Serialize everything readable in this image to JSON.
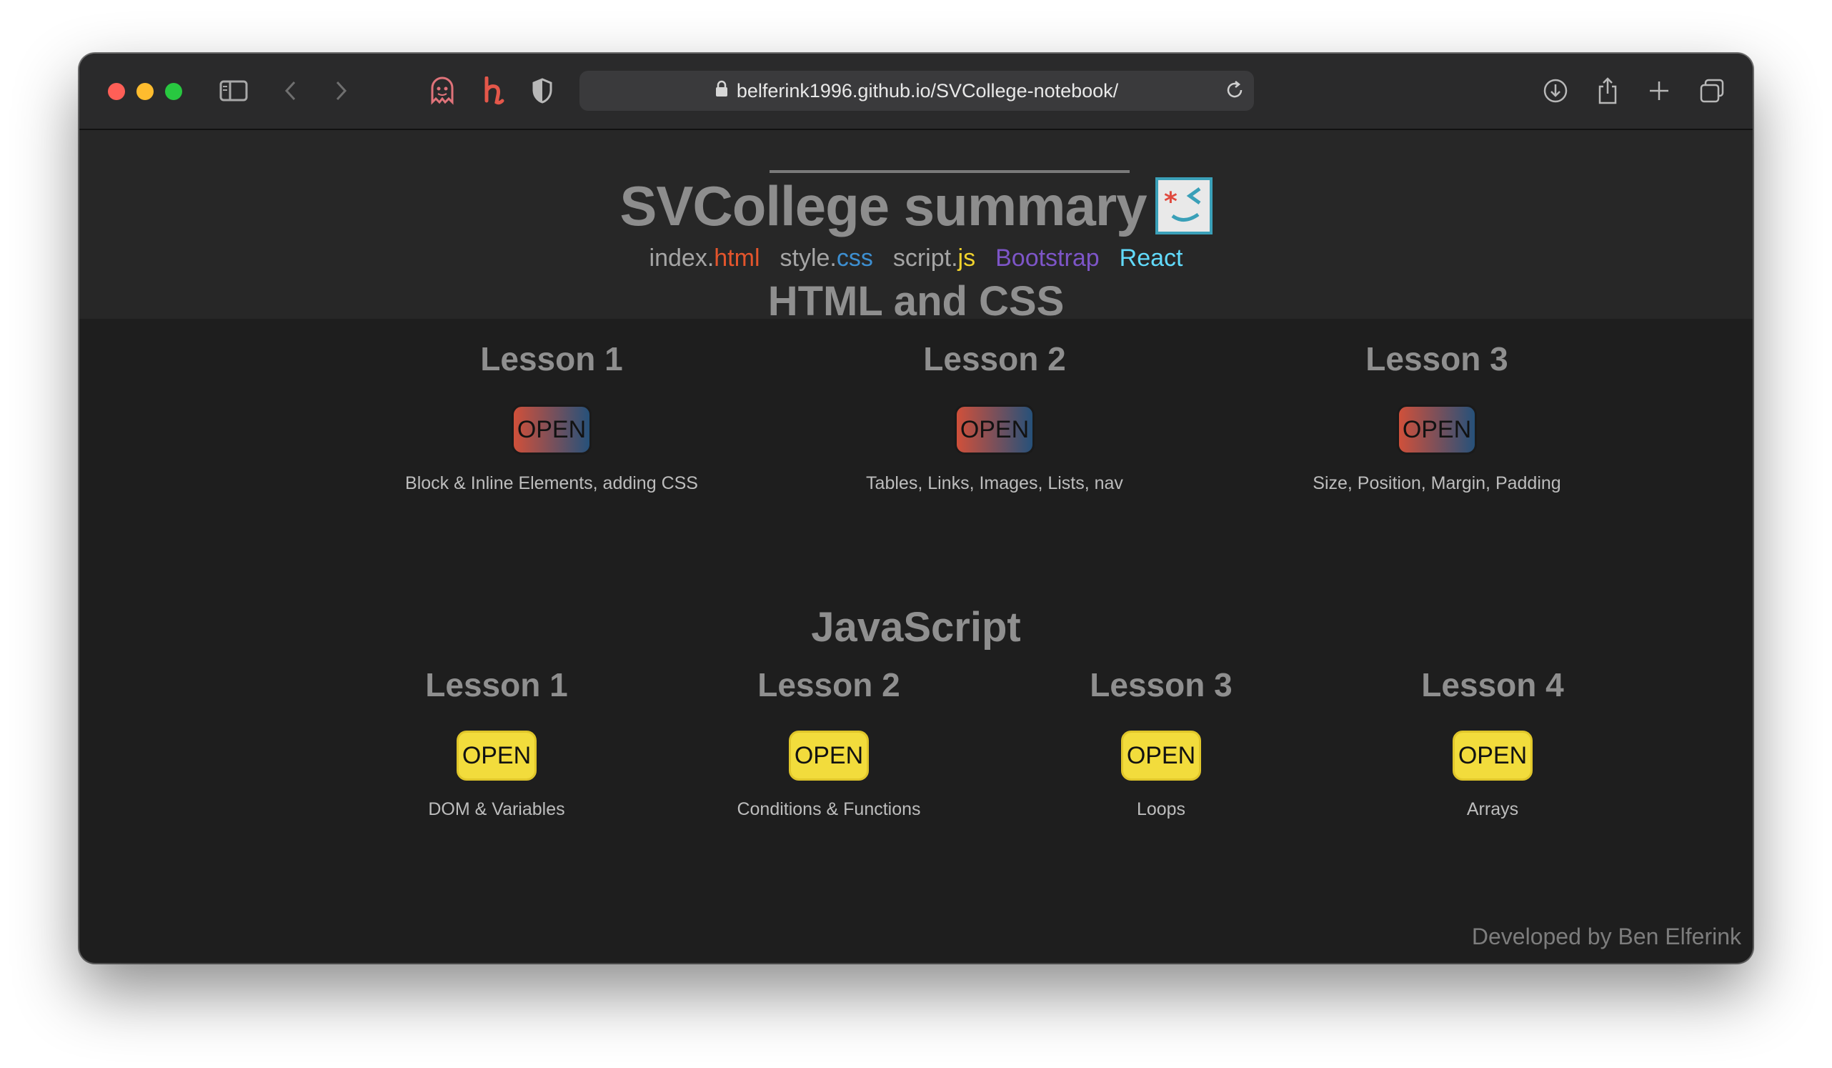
{
  "browser": {
    "url": "belferink1996.github.io/SVCollege-notebook/",
    "icons": [
      "sidebar-icon",
      "back-icon",
      "forward-icon",
      "ghost-extension-icon",
      "honey-extension-icon",
      "privacy-shield-icon",
      "lock-icon",
      "reload-icon",
      "download-icon",
      "share-icon",
      "new-tab-icon",
      "tab-overview-icon"
    ],
    "traffic_lights": {
      "close": "#ff5f57",
      "minimize": "#febc2e",
      "maximize": "#28c840"
    }
  },
  "header": {
    "title": "SVCollege summary",
    "logo_icon": "winking-face-logo-icon",
    "nav": [
      {
        "prefix": "index.",
        "suffix": "html"
      },
      {
        "prefix": "style.",
        "suffix": "css"
      },
      {
        "prefix": "script.",
        "suffix": "js"
      },
      {
        "prefix": "",
        "suffix": "Bootstrap"
      },
      {
        "prefix": "",
        "suffix": "React"
      }
    ]
  },
  "sections": [
    {
      "title": "HTML and CSS",
      "lessons": [
        {
          "title": "Lesson 1",
          "button": "OPEN",
          "description": "Block & Inline Elements, adding CSS"
        },
        {
          "title": "Lesson 2",
          "button": "OPEN",
          "description": "Tables, Links, Images, Lists, nav"
        },
        {
          "title": "Lesson 3",
          "button": "OPEN",
          "description": "Size, Position, Margin, Padding"
        }
      ]
    },
    {
      "title": "JavaScript",
      "lessons": [
        {
          "title": "Lesson 1",
          "button": "OPEN",
          "description": "DOM & Variables"
        },
        {
          "title": "Lesson 2",
          "button": "OPEN",
          "description": "Conditions & Functions"
        },
        {
          "title": "Lesson 3",
          "button": "OPEN",
          "description": "Loops"
        },
        {
          "title": "Lesson 4",
          "button": "OPEN",
          "description": "Arrays"
        }
      ]
    }
  ],
  "footer": {
    "credit": "Developed by Ben Elferink"
  },
  "colors": {
    "html": "#e4552c",
    "css": "#3d8fd1",
    "js": "#f0d22c",
    "bootstrap": "#7d55c7",
    "react": "#61dafb",
    "yellow_button": "#f2dc3c"
  }
}
